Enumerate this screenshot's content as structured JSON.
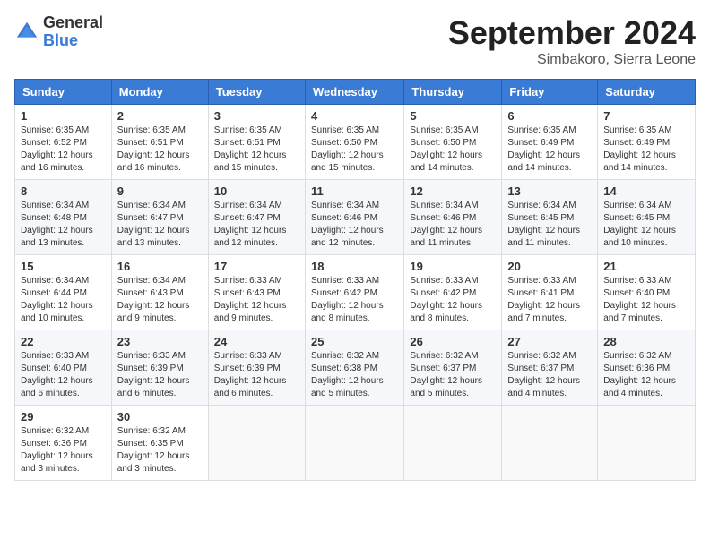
{
  "header": {
    "logo_general": "General",
    "logo_blue": "Blue",
    "month_title": "September 2024",
    "location": "Simbakoro, Sierra Leone"
  },
  "weekdays": [
    "Sunday",
    "Monday",
    "Tuesday",
    "Wednesday",
    "Thursday",
    "Friday",
    "Saturday"
  ],
  "weeks": [
    [
      {
        "day": "1",
        "sunrise": "Sunrise: 6:35 AM",
        "sunset": "Sunset: 6:52 PM",
        "daylight": "Daylight: 12 hours and 16 minutes."
      },
      {
        "day": "2",
        "sunrise": "Sunrise: 6:35 AM",
        "sunset": "Sunset: 6:51 PM",
        "daylight": "Daylight: 12 hours and 16 minutes."
      },
      {
        "day": "3",
        "sunrise": "Sunrise: 6:35 AM",
        "sunset": "Sunset: 6:51 PM",
        "daylight": "Daylight: 12 hours and 15 minutes."
      },
      {
        "day": "4",
        "sunrise": "Sunrise: 6:35 AM",
        "sunset": "Sunset: 6:50 PM",
        "daylight": "Daylight: 12 hours and 15 minutes."
      },
      {
        "day": "5",
        "sunrise": "Sunrise: 6:35 AM",
        "sunset": "Sunset: 6:50 PM",
        "daylight": "Daylight: 12 hours and 14 minutes."
      },
      {
        "day": "6",
        "sunrise": "Sunrise: 6:35 AM",
        "sunset": "Sunset: 6:49 PM",
        "daylight": "Daylight: 12 hours and 14 minutes."
      },
      {
        "day": "7",
        "sunrise": "Sunrise: 6:35 AM",
        "sunset": "Sunset: 6:49 PM",
        "daylight": "Daylight: 12 hours and 14 minutes."
      }
    ],
    [
      {
        "day": "8",
        "sunrise": "Sunrise: 6:34 AM",
        "sunset": "Sunset: 6:48 PM",
        "daylight": "Daylight: 12 hours and 13 minutes."
      },
      {
        "day": "9",
        "sunrise": "Sunrise: 6:34 AM",
        "sunset": "Sunset: 6:47 PM",
        "daylight": "Daylight: 12 hours and 13 minutes."
      },
      {
        "day": "10",
        "sunrise": "Sunrise: 6:34 AM",
        "sunset": "Sunset: 6:47 PM",
        "daylight": "Daylight: 12 hours and 12 minutes."
      },
      {
        "day": "11",
        "sunrise": "Sunrise: 6:34 AM",
        "sunset": "Sunset: 6:46 PM",
        "daylight": "Daylight: 12 hours and 12 minutes."
      },
      {
        "day": "12",
        "sunrise": "Sunrise: 6:34 AM",
        "sunset": "Sunset: 6:46 PM",
        "daylight": "Daylight: 12 hours and 11 minutes."
      },
      {
        "day": "13",
        "sunrise": "Sunrise: 6:34 AM",
        "sunset": "Sunset: 6:45 PM",
        "daylight": "Daylight: 12 hours and 11 minutes."
      },
      {
        "day": "14",
        "sunrise": "Sunrise: 6:34 AM",
        "sunset": "Sunset: 6:45 PM",
        "daylight": "Daylight: 12 hours and 10 minutes."
      }
    ],
    [
      {
        "day": "15",
        "sunrise": "Sunrise: 6:34 AM",
        "sunset": "Sunset: 6:44 PM",
        "daylight": "Daylight: 12 hours and 10 minutes."
      },
      {
        "day": "16",
        "sunrise": "Sunrise: 6:34 AM",
        "sunset": "Sunset: 6:43 PM",
        "daylight": "Daylight: 12 hours and 9 minutes."
      },
      {
        "day": "17",
        "sunrise": "Sunrise: 6:33 AM",
        "sunset": "Sunset: 6:43 PM",
        "daylight": "Daylight: 12 hours and 9 minutes."
      },
      {
        "day": "18",
        "sunrise": "Sunrise: 6:33 AM",
        "sunset": "Sunset: 6:42 PM",
        "daylight": "Daylight: 12 hours and 8 minutes."
      },
      {
        "day": "19",
        "sunrise": "Sunrise: 6:33 AM",
        "sunset": "Sunset: 6:42 PM",
        "daylight": "Daylight: 12 hours and 8 minutes."
      },
      {
        "day": "20",
        "sunrise": "Sunrise: 6:33 AM",
        "sunset": "Sunset: 6:41 PM",
        "daylight": "Daylight: 12 hours and 7 minutes."
      },
      {
        "day": "21",
        "sunrise": "Sunrise: 6:33 AM",
        "sunset": "Sunset: 6:40 PM",
        "daylight": "Daylight: 12 hours and 7 minutes."
      }
    ],
    [
      {
        "day": "22",
        "sunrise": "Sunrise: 6:33 AM",
        "sunset": "Sunset: 6:40 PM",
        "daylight": "Daylight: 12 hours and 6 minutes."
      },
      {
        "day": "23",
        "sunrise": "Sunrise: 6:33 AM",
        "sunset": "Sunset: 6:39 PM",
        "daylight": "Daylight: 12 hours and 6 minutes."
      },
      {
        "day": "24",
        "sunrise": "Sunrise: 6:33 AM",
        "sunset": "Sunset: 6:39 PM",
        "daylight": "Daylight: 12 hours and 6 minutes."
      },
      {
        "day": "25",
        "sunrise": "Sunrise: 6:32 AM",
        "sunset": "Sunset: 6:38 PM",
        "daylight": "Daylight: 12 hours and 5 minutes."
      },
      {
        "day": "26",
        "sunrise": "Sunrise: 6:32 AM",
        "sunset": "Sunset: 6:37 PM",
        "daylight": "Daylight: 12 hours and 5 minutes."
      },
      {
        "day": "27",
        "sunrise": "Sunrise: 6:32 AM",
        "sunset": "Sunset: 6:37 PM",
        "daylight": "Daylight: 12 hours and 4 minutes."
      },
      {
        "day": "28",
        "sunrise": "Sunrise: 6:32 AM",
        "sunset": "Sunset: 6:36 PM",
        "daylight": "Daylight: 12 hours and 4 minutes."
      }
    ],
    [
      {
        "day": "29",
        "sunrise": "Sunrise: 6:32 AM",
        "sunset": "Sunset: 6:36 PM",
        "daylight": "Daylight: 12 hours and 3 minutes."
      },
      {
        "day": "30",
        "sunrise": "Sunrise: 6:32 AM",
        "sunset": "Sunset: 6:35 PM",
        "daylight": "Daylight: 12 hours and 3 minutes."
      },
      null,
      null,
      null,
      null,
      null
    ]
  ]
}
